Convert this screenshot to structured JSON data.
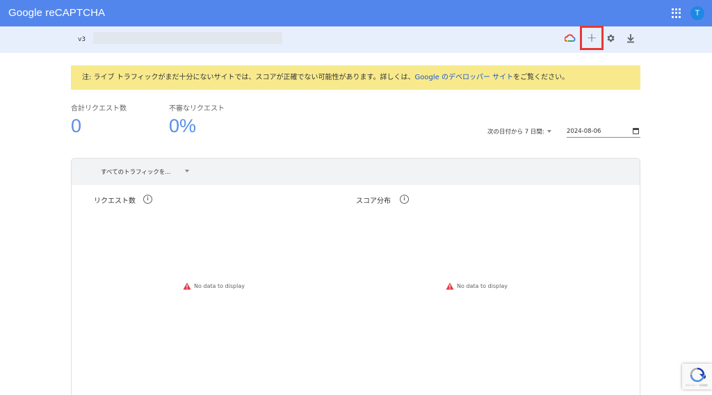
{
  "header": {
    "brand": "Google reCAPTCHA",
    "avatar_letter": "T"
  },
  "subbar": {
    "version": "v3",
    "add_label": "+"
  },
  "notice": {
    "prefix": "注: ライブ トラフィックがまだ十分にないサイトでは、スコアが正確でない可能性があります。詳しくは、",
    "link": "Google のデベロッパー サイト",
    "suffix": "をご覧ください。"
  },
  "stats": {
    "total_label": "合計リクエスト数",
    "total_value": "0",
    "suspicious_label": "不審なリクエスト",
    "suspicious_value": "0%"
  },
  "range": {
    "selected": "次の日付から 7 日間:",
    "date": "2024-08-06"
  },
  "panel": {
    "filter": "すべてのトラフィックを...",
    "requests_title": "リクエスト数",
    "score_title": "スコア分布",
    "no_data": "No data to display"
  },
  "badge": {
    "text": "プライバシー・利用規約"
  },
  "colors": {
    "topbar": "#5386ec",
    "subbar": "#e8effc",
    "notice": "#f8ea8c",
    "accent": "#5a8ee8",
    "highlight": "#e53935"
  }
}
